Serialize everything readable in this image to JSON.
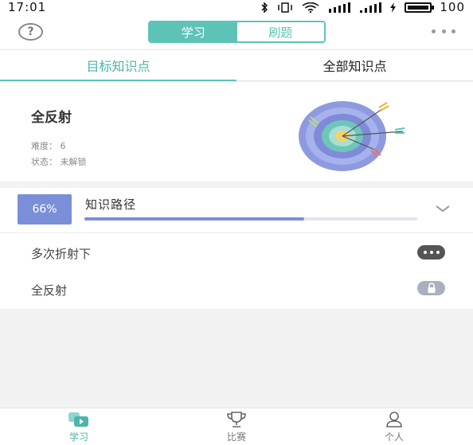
{
  "status_bar": {
    "time": "17:01",
    "battery": "100"
  },
  "header": {
    "segments": [
      "学习",
      "刷题"
    ],
    "active_segment": "学习",
    "accent_color": "#5ec3b7"
  },
  "tabs": [
    {
      "label": "目标知识点",
      "active": true
    },
    {
      "label": "全部知识点",
      "active": false
    }
  ],
  "knowledge_card": {
    "title": "全反射",
    "difficulty": "难度： 6",
    "status": "状态： 未解锁"
  },
  "path": {
    "percent_label": "66%",
    "progress": 0.66,
    "title": "知识路径",
    "badge_color": "#7b8fd8",
    "items": [
      {
        "label": "多次折射下",
        "action_icon": "more-dots-icon"
      },
      {
        "label": "全反射",
        "action_icon": "lock-icon"
      }
    ]
  },
  "bottom_nav": [
    {
      "label": "学习",
      "icon": "study-icon",
      "active": true
    },
    {
      "label": "比赛",
      "icon": "trophy-icon",
      "active": false
    },
    {
      "label": "个人",
      "icon": "person-icon",
      "active": false
    }
  ]
}
